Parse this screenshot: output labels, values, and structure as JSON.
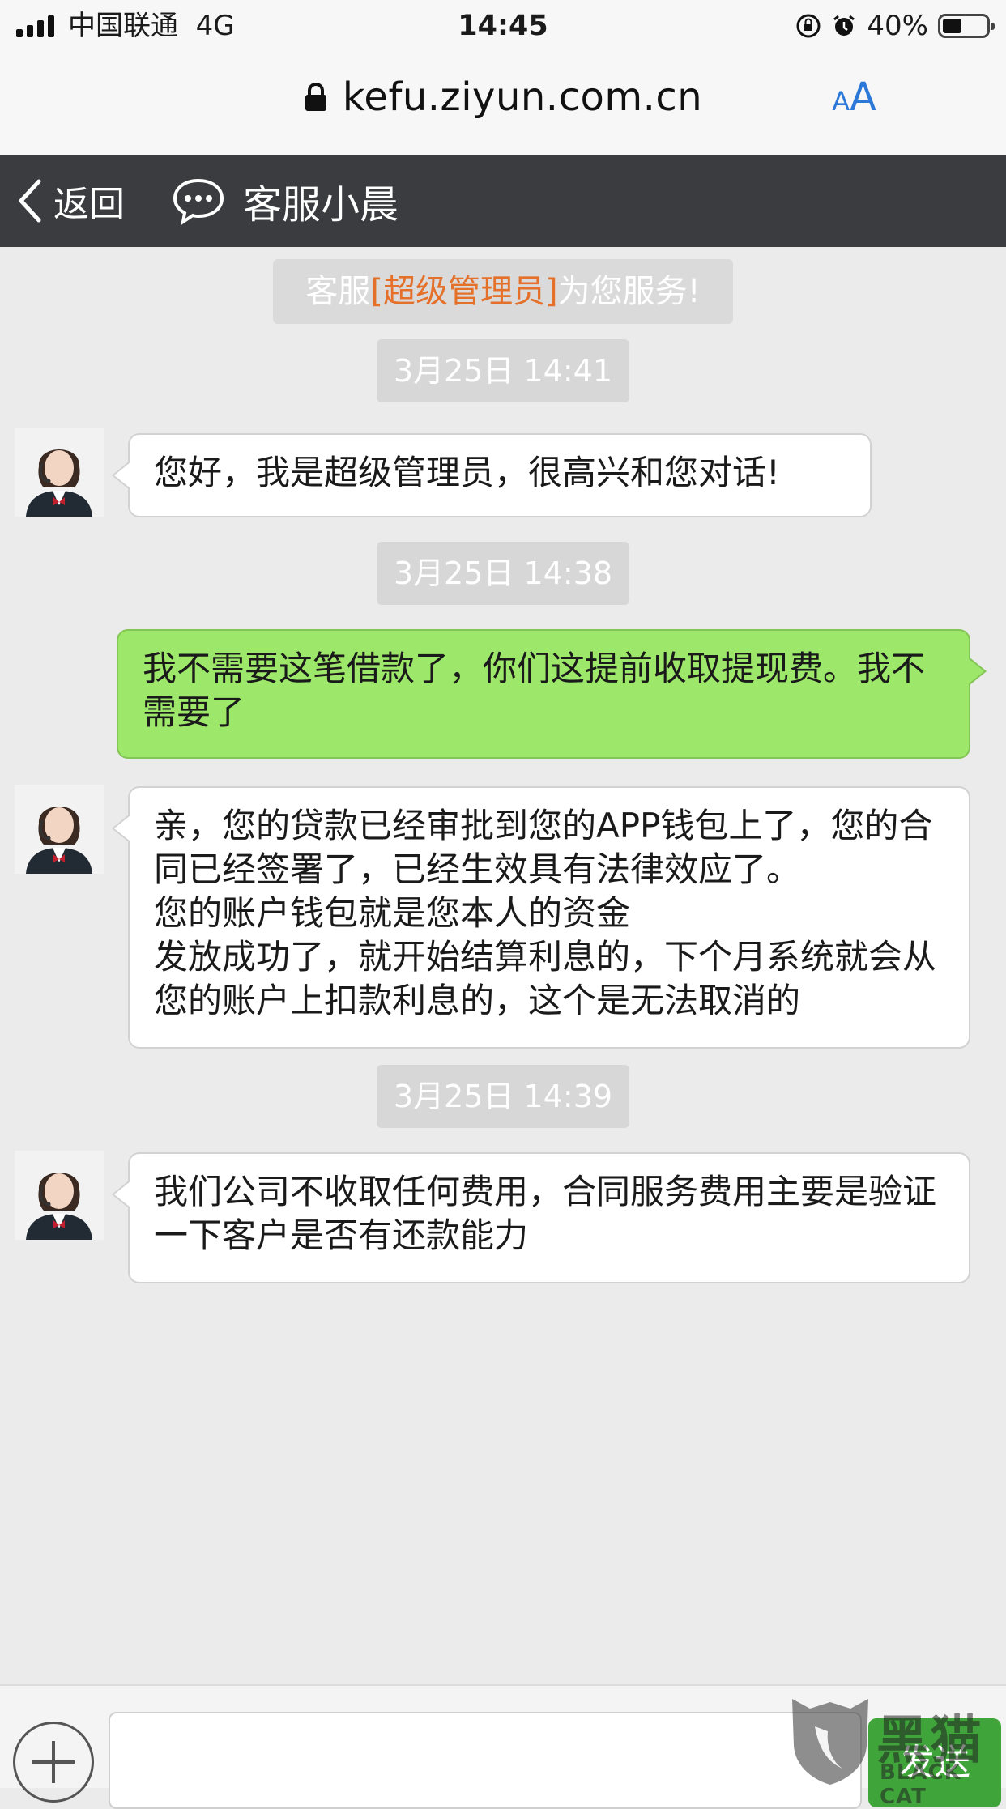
{
  "status_bar": {
    "carrier": "中国联通",
    "network": "4G",
    "time": "14:45",
    "battery": "40%",
    "battery_level": 0.4
  },
  "url_bar": {
    "url": "kefu.ziyun.com.cn",
    "text_size_small": "A",
    "text_size_large": "A"
  },
  "nav": {
    "back_label": "返回",
    "title": "客服小晨"
  },
  "system_message": {
    "prefix": "客服",
    "highlight": "[超级管理员]",
    "suffix": "为您服务!"
  },
  "timestamps": [
    "3月25日 14:41",
    "3月25日 14:38",
    "3月25日 14:39"
  ],
  "messages": [
    {
      "sender": "agent",
      "text": "您好，我是超级管理员，很高兴和您对话!"
    },
    {
      "sender": "user",
      "text": "我不需要这笔借款了，你们这提前收取提现费。我不需要了"
    },
    {
      "sender": "agent",
      "text": "亲，您的贷款已经审批到您的APP钱包上了，您的合同已经签署了，已经生效具有法律效应了。\n您的账户钱包就是您本人的资金\n发放成功了，就开始结算利息的，下个月系统就会从您的账户上扣款利息的，这个是无法取消的"
    },
    {
      "sender": "agent",
      "text": "我们公司不收取任何费用，合同服务费用主要是验证一下客户是否有还款能力"
    }
  ],
  "input_bar": {
    "placeholder": "",
    "send_label": "发送"
  },
  "watermark": {
    "cn": "黑猫",
    "en": "BLACK CAT"
  },
  "colors": {
    "navbar_bg": "#3b3c40",
    "user_bubble": "#9de76a",
    "highlight": "#e4702a",
    "link_blue": "#2a78d8",
    "send_button": "#3fa53a"
  }
}
